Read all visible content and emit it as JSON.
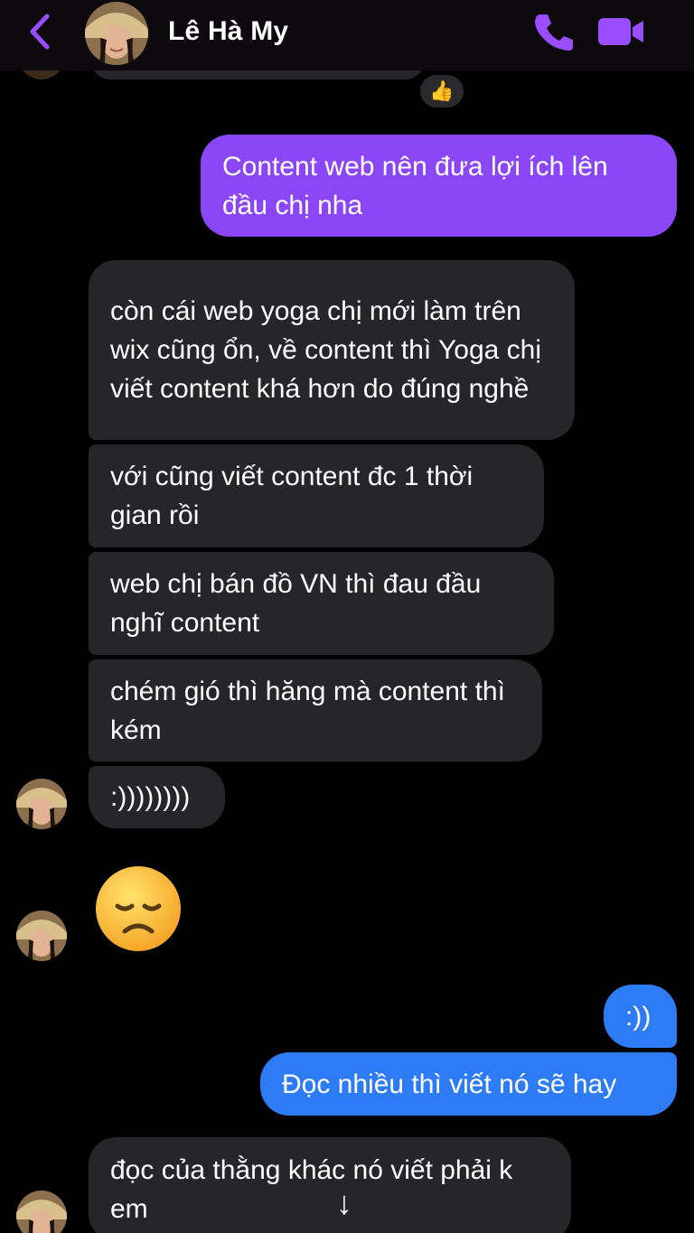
{
  "header": {
    "contact_name": "Lê Hà My",
    "accent_color": "#9a4dff"
  },
  "icons": {
    "back": "chevron-left-icon",
    "call": "phone-icon",
    "video": "video-camera-icon",
    "reaction": "thumbs-up-icon",
    "scroll": "arrow-down-icon"
  },
  "messages": [
    {
      "sender": "me",
      "text": "Content web nên đưa lợi ích lên đầu chị nha",
      "color": "#8b47f7"
    },
    {
      "sender": "them",
      "text": "còn cái web yoga chị mới làm trên wix cũng ổn, về content thì Yoga chị viết content khá hơn do đúng nghề"
    },
    {
      "sender": "them",
      "text": "với cũng viết content đc 1 thời gian rồi"
    },
    {
      "sender": "them",
      "text": "web chị bán đồ VN thì đau đầu nghĩ content"
    },
    {
      "sender": "them",
      "text": "chém gió thì hăng mà content thì kém"
    },
    {
      "sender": "them",
      "text": ":))))))))"
    },
    {
      "sender": "them",
      "text": "😞"
    },
    {
      "sender": "me",
      "text": ":))",
      "color": "#2d7cf6"
    },
    {
      "sender": "me",
      "text": "Đọc nhiều thì viết nó sẽ hay",
      "color": "#2d7cf6"
    },
    {
      "sender": "them",
      "text": "đọc của thằng khác nó viết phải k em"
    }
  ],
  "reaction": {
    "emoji": "👍"
  },
  "scroll_button": {
    "glyph": "↓"
  }
}
